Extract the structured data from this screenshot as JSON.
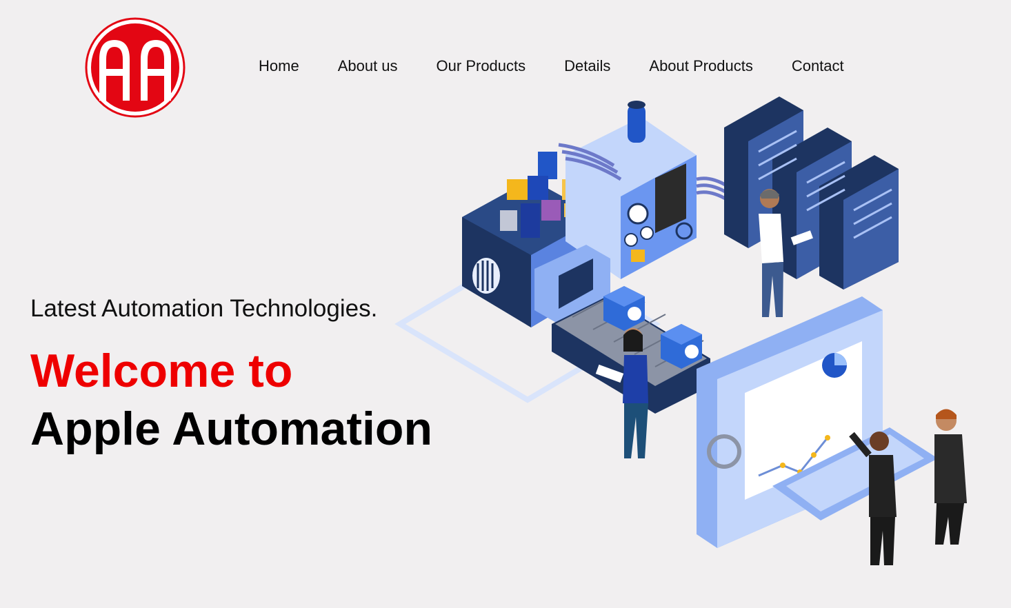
{
  "logo": {
    "text": "AA",
    "color": "#e30613"
  },
  "nav": {
    "items": [
      {
        "label": "Home"
      },
      {
        "label": "About us"
      },
      {
        "label": "Our Products"
      },
      {
        "label": "Details"
      },
      {
        "label": "About Products"
      },
      {
        "label": "Contact"
      }
    ]
  },
  "hero": {
    "tagline": "Latest Automation Technologies.",
    "welcome": "Welcome to",
    "brand": "Apple Automation"
  },
  "colors": {
    "background": "#f1eff0",
    "accent": "#ee0000",
    "text": "#111111",
    "illustration_navy": "#1d3461",
    "illustration_light_blue": "#c3d6fb"
  },
  "illustration": {
    "icon": "factory-automation-illustration"
  }
}
